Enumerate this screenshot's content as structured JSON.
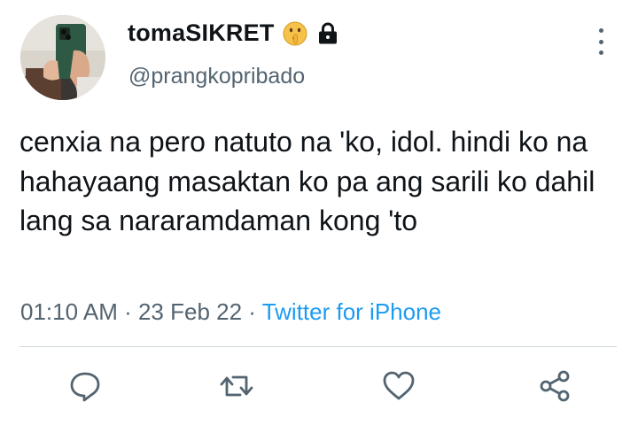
{
  "user": {
    "display_name": "tomaSIKRET",
    "handle": "@prangkopribado",
    "name_icons": [
      "shushing-face-emoji-icon",
      "lock-icon"
    ]
  },
  "tweet": {
    "text": "cenxia na pero natuto na 'ko, idol. hindi ko na hahayaang masaktan ko pa ang sarili ko dahil lang sa nararamdaman kong 'to",
    "time": "01:10 AM",
    "date": "23 Feb 22",
    "separator": " · ",
    "source": "Twitter for iPhone"
  },
  "actions": [
    "reply-icon",
    "retweet-icon",
    "like-icon",
    "share-icon"
  ],
  "colors": {
    "text": "#0f1419",
    "secondary": "#536471",
    "link": "#1d9bf0",
    "divider": "#cfd9de"
  }
}
